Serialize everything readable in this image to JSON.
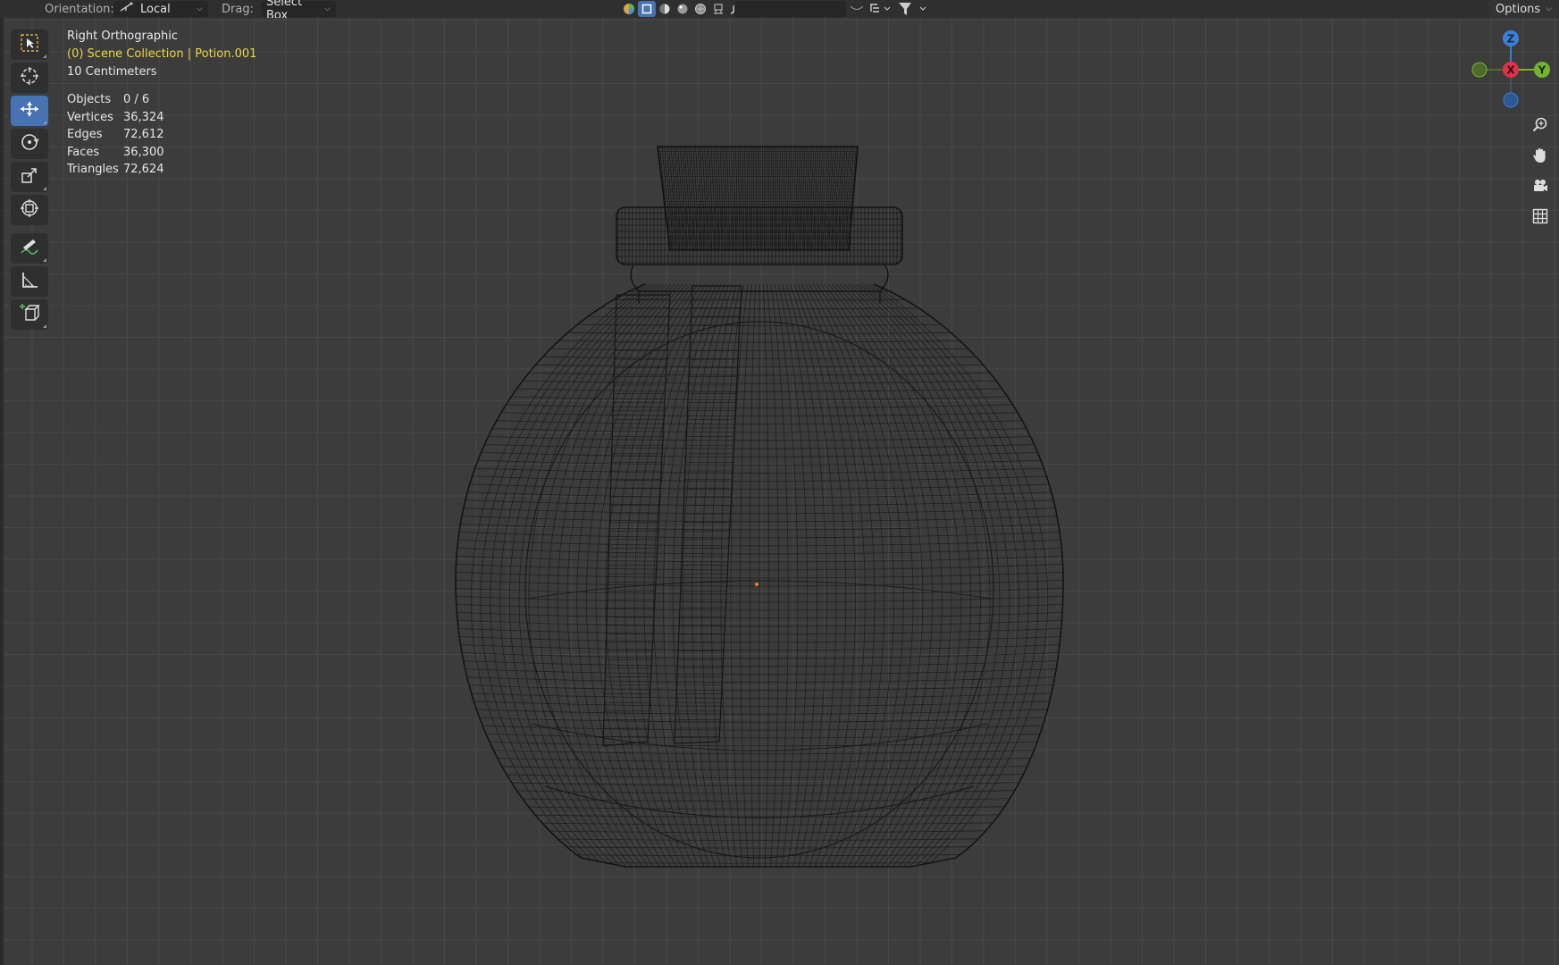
{
  "header": {
    "orientation_label": "Orientation:",
    "orientation_value": "Local",
    "drag_label": "Drag:",
    "drag_value": "Select Box",
    "options_label": "Options"
  },
  "viewport": {
    "view_name": "Right Orthographic",
    "collection": "(0) Scene Collection | Potion.001",
    "scale": "10 Centimeters"
  },
  "stats": {
    "objects_label": "Objects",
    "objects_value": "0 / 6",
    "vertices_label": "Vertices",
    "vertices_value": "36,324",
    "edges_label": "Edges",
    "edges_value": "72,612",
    "faces_label": "Faces",
    "faces_value": "36,300",
    "triangles_label": "Triangles",
    "triangles_value": "72,624"
  },
  "gizmo": {
    "z": "Z",
    "x": "X",
    "y": "Y"
  },
  "colors": {
    "active_tool": "#4772b3",
    "collection_text": "#e8d84a",
    "axis_x": "#e0334a",
    "axis_y": "#74b52d",
    "axis_z": "#3b80d6"
  },
  "toolbar": {
    "tools": [
      "select-box-icon",
      "cursor-icon",
      "move-icon",
      "rotate-icon",
      "scale-icon",
      "transform-icon",
      "annotate-icon",
      "measure-icon",
      "add-cube-icon"
    ],
    "active": "move-icon"
  }
}
